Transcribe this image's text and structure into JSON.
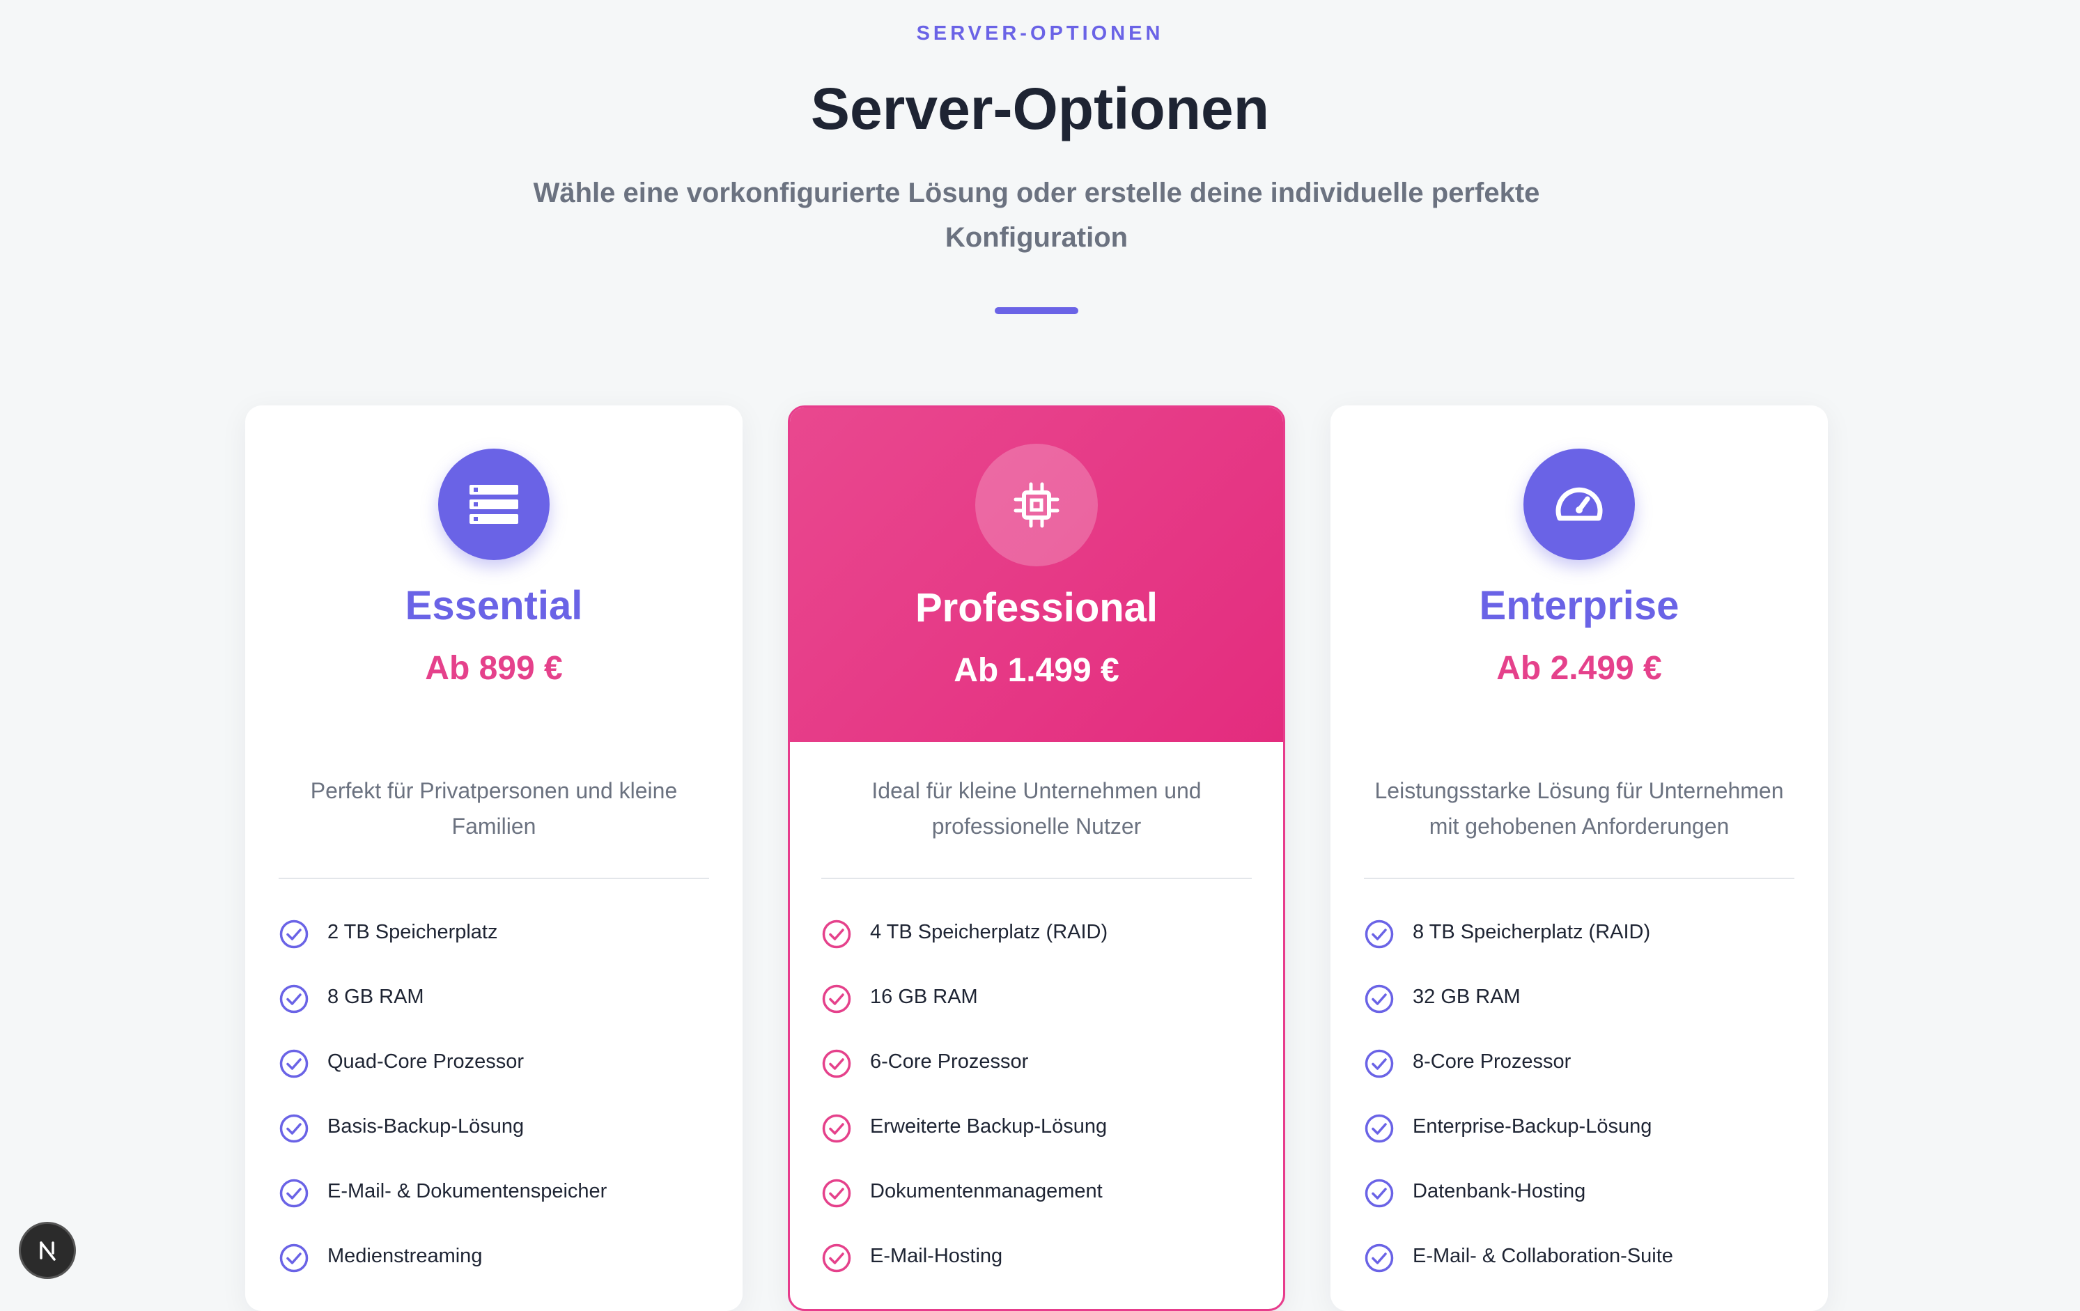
{
  "header": {
    "eyebrow": "SERVER-OPTIONEN",
    "title": "Server-Optionen",
    "subtitle": "Wähle eine vorkonfigurierte Lösung oder erstelle deine individuelle perfekte Konfiguration"
  },
  "colors": {
    "primary": "#6a63e6",
    "accent": "#e5418b",
    "highlight_gradient_start": "#e9488f",
    "highlight_gradient_end": "#e32c7e"
  },
  "plans": [
    {
      "icon": "server-stack-icon",
      "name": "Essential",
      "price": "Ab 899 €",
      "description": "Perfekt für Privatpersonen und kleine Familien",
      "features": [
        "2 TB Speicherplatz",
        "8 GB RAM",
        "Quad-Core Prozessor",
        "Basis-Backup-Lösung",
        "E-Mail- & Dokumentenspeicher",
        "Medienstreaming"
      ]
    },
    {
      "icon": "cpu-chip-icon",
      "name": "Professional",
      "price": "Ab 1.499 €",
      "description": "Ideal für kleine Unternehmen und professionelle Nutzer",
      "features": [
        "4 TB Speicherplatz (RAID)",
        "16 GB RAM",
        "6-Core Prozessor",
        "Erweiterte Backup-Lösung",
        "Dokumentenmanagement",
        "E-Mail-Hosting"
      ]
    },
    {
      "icon": "speedometer-icon",
      "name": "Enterprise",
      "price": "Ab 2.499 €",
      "description": "Leistungsstarke Lösung für Unternehmen mit gehobenen Anforderungen",
      "features": [
        "8 TB Speicherplatz (RAID)",
        "32 GB RAM",
        "8-Core Prozessor",
        "Enterprise-Backup-Lösung",
        "Datenbank-Hosting",
        "E-Mail- & Collaboration-Suite"
      ]
    }
  ],
  "badge": {
    "label": "N"
  }
}
